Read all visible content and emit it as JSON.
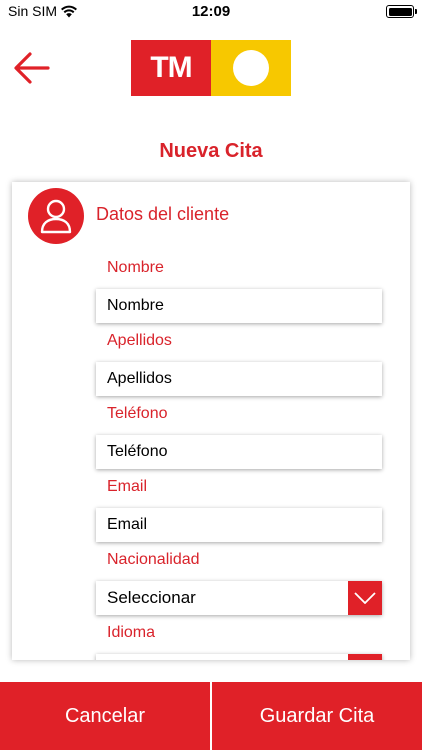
{
  "status_bar": {
    "carrier": "Sin SIM",
    "time": "12:09"
  },
  "header": {
    "logo_text": "TM"
  },
  "page": {
    "title": "Nueva Cita"
  },
  "client_section": {
    "title": "Datos del cliente",
    "fields": {
      "nombre": {
        "label": "Nombre",
        "placeholder": "Nombre"
      },
      "apellidos": {
        "label": "Apellidos",
        "placeholder": "Apellidos"
      },
      "telefono": {
        "label": "Teléfono",
        "placeholder": "Teléfono"
      },
      "email": {
        "label": "Email",
        "placeholder": "Email"
      },
      "nacionalidad": {
        "label": "Nacionalidad",
        "value": "Seleccionar"
      },
      "idioma": {
        "label": "Idioma",
        "value": ""
      }
    }
  },
  "actions": {
    "cancel_label": "Cancelar",
    "save_label": "Guardar Cita"
  },
  "colors": {
    "brand_red": "#e02128",
    "label_red": "#d9232b",
    "logo_yellow": "#f7c800"
  },
  "icons": {
    "back": "arrow-left-icon",
    "user": "user-icon",
    "dropdown": "chevron-down-icon"
  }
}
